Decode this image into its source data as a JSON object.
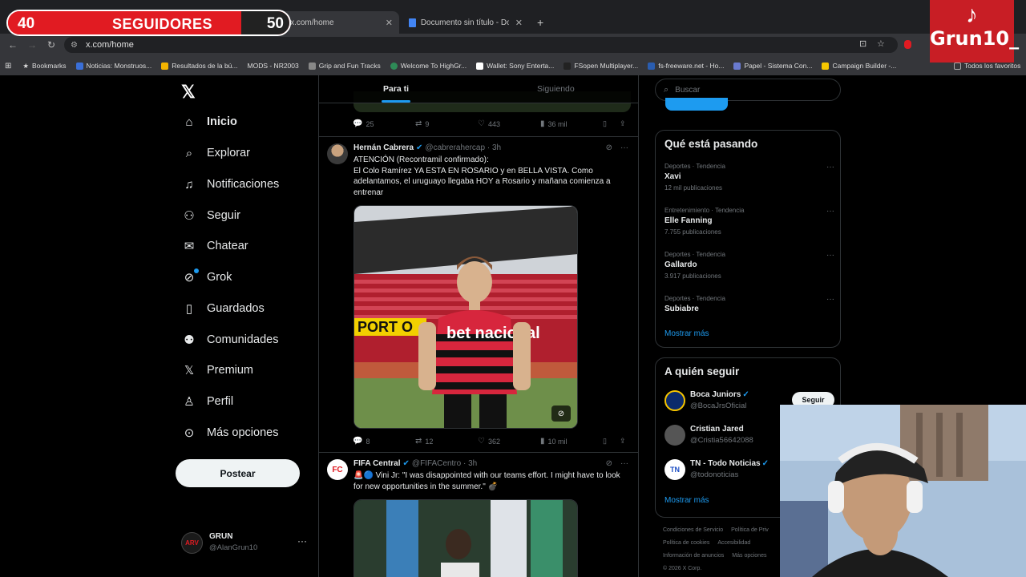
{
  "overlay": {
    "left_count": "40",
    "title": "SEGUIDORES",
    "right_count": "50",
    "tiktok_name": "Grun10_"
  },
  "browser": {
    "tabs": [
      {
        "label": "Documento sin título - Documen"
      },
      {
        "label": "x.com/home"
      }
    ],
    "url": "x.com/home",
    "bookmarks": [
      "Bookmarks",
      "Noticias: Monstruos...",
      "Resultados de la bú...",
      "MODS - NR2003",
      "Grip and Fun Tracks",
      "Welcome To HighGr...",
      "Wallet: Sony Enterta...",
      "FSopen Multiplayer...",
      "fs-freeware.net - Ho...",
      "Papel - Sistema Con...",
      "Campaign Builder -..."
    ],
    "bookmarks_all": "Todos los favoritos"
  },
  "nav": {
    "items": [
      {
        "label": "Inicio",
        "icon": "home-icon"
      },
      {
        "label": "Explorar",
        "icon": "search-icon"
      },
      {
        "label": "Notificaciones",
        "icon": "bell-icon"
      },
      {
        "label": "Seguir",
        "icon": "person-add-icon"
      },
      {
        "label": "Chatear",
        "icon": "mail-icon"
      },
      {
        "label": "Grok",
        "icon": "grok-icon"
      },
      {
        "label": "Guardados",
        "icon": "bookmark-icon"
      },
      {
        "label": "Comunidades",
        "icon": "communities-icon"
      },
      {
        "label": "Premium",
        "icon": "x-logo-icon"
      },
      {
        "label": "Perfil",
        "icon": "person-icon"
      },
      {
        "label": "Más opciones",
        "icon": "more-circle-icon"
      }
    ],
    "post_label": "Postear",
    "profile": {
      "name": "GRUN",
      "handle": "@AlanGrun10"
    }
  },
  "feed": {
    "tabs": [
      "Para ti",
      "Siguiendo"
    ],
    "prev_actions": {
      "replies": "25",
      "reposts": "9",
      "likes": "443",
      "views": "36 mil"
    },
    "tweets": [
      {
        "name": "Hernán Cabrera",
        "handle": "@cabrerahercap",
        "time": "3h",
        "lines": [
          "ATENCIÓN (Recontramil confirmado):",
          "El Colo Ramírez YA ESTA EN ROSARIO y en BELLA VISTA. Como adelantamos, el uruguayo llegaba HOY a Rosario y mañana comienza a entrenar"
        ],
        "media_text": {
          "sign": "PORT O",
          "sponsor": "bet nacional"
        },
        "actions": {
          "replies": "8",
          "reposts": "12",
          "likes": "362",
          "views": "10 mil"
        }
      },
      {
        "name": "FIFA Central",
        "handle": "@FIFACentro",
        "time": "3h",
        "text": "🚨🔵 Vini Jr: \"I was disappointed with our teams effort. I might have to look for new opportunities in the summer.\" 💣"
      }
    ]
  },
  "sidebar": {
    "search_placeholder": "Buscar",
    "trends_title": "Qué está pasando",
    "trends": [
      {
        "category": "Deportes · Tendencia",
        "title": "Xavi",
        "count": "12 mil publicaciones"
      },
      {
        "category": "Entretenimiento · Tendencia",
        "title": "Elle Fanning",
        "count": "7.755 publicaciones"
      },
      {
        "category": "Deportes · Tendencia",
        "title": "Gallardo",
        "count": "3.917 publicaciones"
      },
      {
        "category": "Deportes · Tendencia",
        "title": "Subiabre",
        "count": ""
      }
    ],
    "show_more": "Mostrar más",
    "follow_title": "A quién seguir",
    "follow": [
      {
        "name": "Boca Juniors",
        "handle": "@BocaJrsOficial",
        "verified": "✓"
      },
      {
        "name": "Cristian Jared",
        "handle": "@Cristia56642088",
        "verified": ""
      },
      {
        "name": "TN - Todo Noticias",
        "handle": "@todonoticias",
        "verified": "✓"
      }
    ],
    "follow_button": "Seguir",
    "footer": [
      "Condiciones de Servicio",
      "Política de Priv",
      "Política de cookies",
      "Accesibilidad",
      "Información de anuncios",
      "Más opciones",
      "© 2026 X Corp."
    ]
  },
  "colors": {
    "accent": "#1d9bf0",
    "background": "#000000",
    "overlay_red": "#e11b22"
  }
}
